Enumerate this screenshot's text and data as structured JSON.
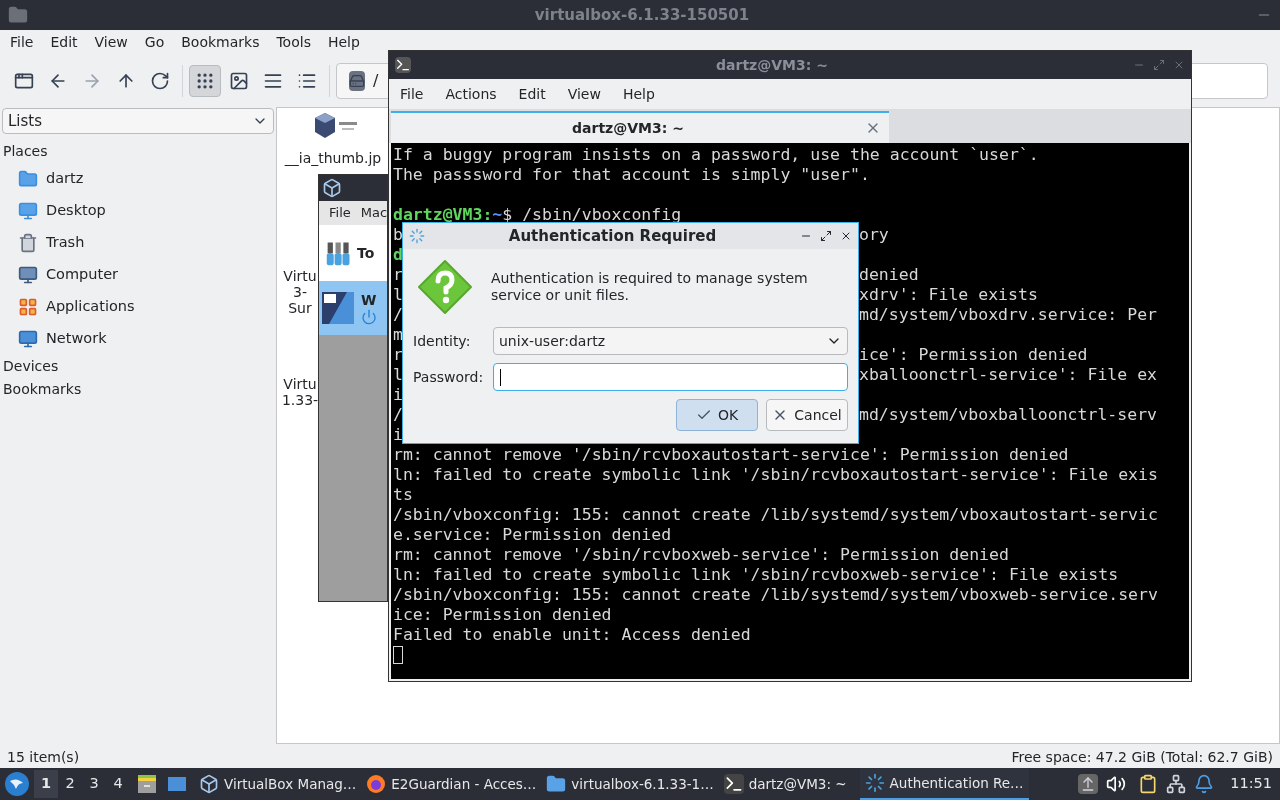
{
  "file_manager": {
    "title": "virtualbox-6.1.33-150501",
    "menu": [
      "File",
      "Edit",
      "View",
      "Go",
      "Bookmarks",
      "Tools",
      "Help"
    ],
    "nav": [
      {
        "kind": "new_tab",
        "disabled": false
      },
      {
        "kind": "back",
        "disabled": false
      },
      {
        "kind": "forward",
        "disabled": true
      },
      {
        "kind": "up",
        "disabled": false
      },
      {
        "kind": "reload",
        "disabled": false
      }
    ],
    "view_modes": [
      {
        "kind": "icons",
        "selected": true
      },
      {
        "kind": "thumbnails",
        "selected": false
      },
      {
        "kind": "compact",
        "selected": false
      },
      {
        "kind": "details",
        "selected": false
      }
    ],
    "path_button": "/",
    "sidebar": {
      "dropdown": "Lists",
      "sections": [
        {
          "heading": "Places",
          "items": [
            {
              "kind": "home",
              "label": "dartz"
            },
            {
              "kind": "desktop",
              "label": "Desktop"
            },
            {
              "kind": "trash",
              "label": "Trash"
            },
            {
              "kind": "computer",
              "label": "Computer"
            },
            {
              "kind": "applications",
              "label": "Applications"
            },
            {
              "kind": "network",
              "label": "Network"
            }
          ]
        },
        {
          "heading": "Devices"
        },
        {
          "heading": "Bookmarks"
        }
      ]
    },
    "files": [
      {
        "kind": "thumbnail",
        "lines": [
          "__ia_thumb.jp"
        ]
      },
      {
        "kind": "plain",
        "lines": [
          "Virtu",
          "3-",
          "Sur"
        ]
      },
      {
        "kind": "plain",
        "lines": [
          "Virtu",
          "1.33-"
        ]
      }
    ],
    "status_left": "15 item(s)",
    "status_right": "Free space: 47.2 GiB (Total: 62.7 GiB)"
  },
  "virtualbox_window": {
    "menu": [
      "File",
      "Mac"
    ],
    "tools_label": "To",
    "vm": {
      "name": "W",
      "selected": true
    }
  },
  "terminal": {
    "title": "dartz@VM3: ~",
    "menu": [
      "File",
      "Actions",
      "Edit",
      "View",
      "Help"
    ],
    "tab": {
      "label": "dartz@VM3: ~",
      "selected": true
    },
    "lines": [
      {
        "kind": "text",
        "text": "If a buggy program insists on a password, use the account `user`."
      },
      {
        "kind": "text",
        "text": "The passsword for that account is simply \"user\"."
      },
      {
        "kind": "blank"
      },
      {
        "kind": "prompt",
        "user": "dartz@VM3:",
        "path": "~",
        "command": "$ /sbin/vboxconfig"
      },
      {
        "kind": "split",
        "start": "b",
        "end": "ory"
      },
      {
        "kind": "prompt_fragment",
        "start": "d"
      },
      {
        "kind": "split",
        "start": "r",
        "end": "denied"
      },
      {
        "kind": "split",
        "start": "l",
        "end": "xdrv': File exists"
      },
      {
        "kind": "split",
        "start": "/",
        "end": "md/system/vboxdrv.service: Per"
      },
      {
        "kind": "split",
        "start": "m"
      },
      {
        "kind": "split",
        "start": "r",
        "end": "ice': Permission denied"
      },
      {
        "kind": "split",
        "start": "l",
        "end": "xballoonctrl-service': File ex"
      },
      {
        "kind": "split",
        "start": "i"
      },
      {
        "kind": "split",
        "start": "/",
        "end": "md/system/vboxballoonctrl-serv"
      },
      {
        "kind": "split",
        "start": "i"
      },
      {
        "kind": "text",
        "text": "rm: cannot remove '/sbin/rcvboxautostart-service': Permission denied"
      },
      {
        "kind": "text",
        "text": "ln: failed to create symbolic link '/sbin/rcvboxautostart-service': File exis"
      },
      {
        "kind": "text",
        "text": "ts"
      },
      {
        "kind": "text",
        "text": "/sbin/vboxconfig: 155: cannot create /lib/systemd/system/vboxautostart-servic"
      },
      {
        "kind": "text",
        "text": "e.service: Permission denied"
      },
      {
        "kind": "text",
        "text": "rm: cannot remove '/sbin/rcvboxweb-service': Permission denied"
      },
      {
        "kind": "text",
        "text": "ln: failed to create symbolic link '/sbin/rcvboxweb-service': File exists"
      },
      {
        "kind": "text",
        "text": "/sbin/vboxconfig: 155: cannot create /lib/systemd/system/vboxweb-service.serv"
      },
      {
        "kind": "text",
        "text": "ice: Permission denied"
      },
      {
        "kind": "text",
        "text": "Failed to enable unit: Access denied"
      },
      {
        "kind": "cursor"
      }
    ]
  },
  "dialog": {
    "title": "Authentication Required",
    "message": "Authentication is required to manage system service or unit files.",
    "identity_label": "Identity:",
    "identity_value": "unix-user:dartz",
    "password_label": "Password:",
    "buttons": [
      {
        "kind": "ok",
        "label": "OK",
        "selected": true
      },
      {
        "kind": "cancel",
        "label": "Cancel",
        "selected": false
      }
    ]
  },
  "taskbar": {
    "workspaces": [
      {
        "label": "1",
        "selected": true
      },
      {
        "label": "2",
        "selected": false
      },
      {
        "label": "3",
        "selected": false
      },
      {
        "label": "4",
        "selected": false
      }
    ],
    "tasks": [
      {
        "kind": "virtualbox",
        "label": "VirtualBox Manag…",
        "selected": false
      },
      {
        "kind": "browser",
        "label": "E2Guardian - Acces…",
        "selected": false
      },
      {
        "kind": "folder",
        "label": "virtualbox-6.1.33-1…",
        "selected": false
      },
      {
        "kind": "terminal",
        "label": "dartz@VM3: ~",
        "selected": false
      },
      {
        "kind": "auth",
        "label": "Authentication Re…",
        "selected": true
      }
    ],
    "clock": "11:51"
  }
}
